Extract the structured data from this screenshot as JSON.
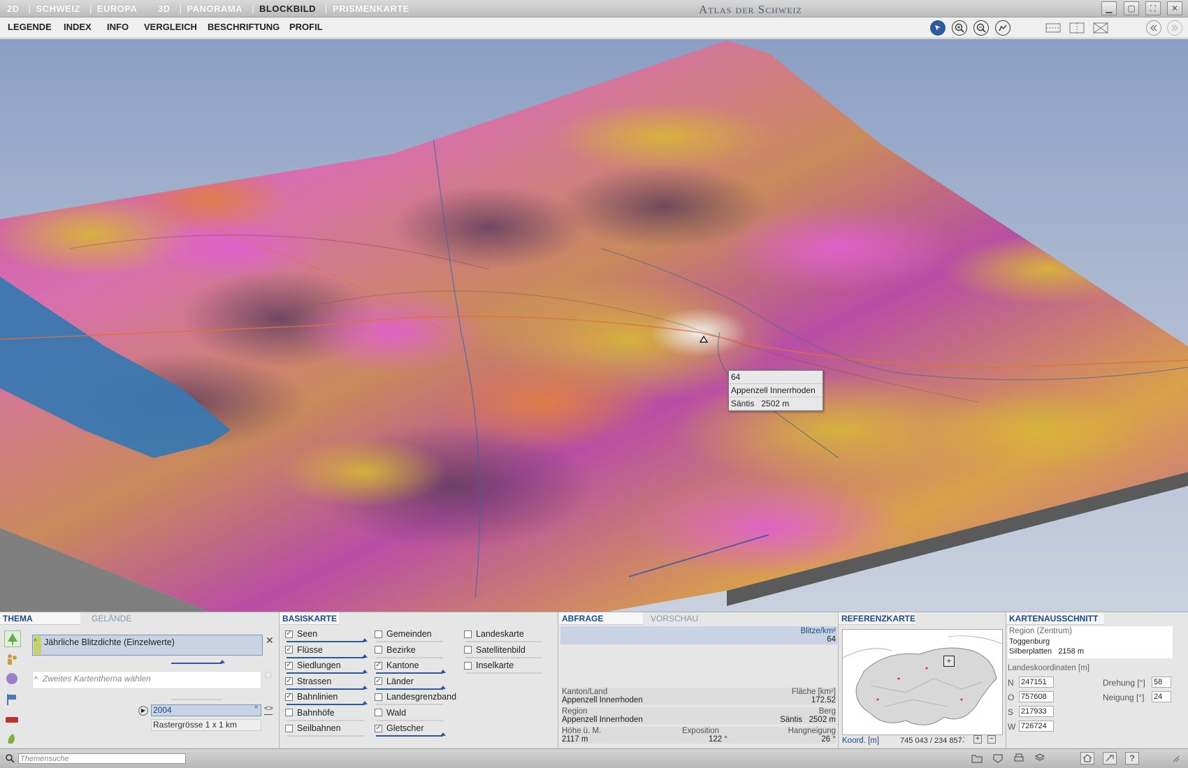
{
  "topbar": {
    "group2d": {
      "label": "2D",
      "items": [
        "SCHWEIZ",
        "EUROPA"
      ]
    },
    "group3d": {
      "label": "3D",
      "items": [
        "PANORAMA",
        "BLOCKBILD",
        "PRISMENKARTE"
      ],
      "active": "BLOCKBILD"
    },
    "title": "Atlas der Schweiz"
  },
  "menu": {
    "items": [
      "LEGENDE",
      "INDEX",
      "INFO",
      "VERGLEICH",
      "BESCHRIFTUNG",
      "PROFIL"
    ]
  },
  "tooltip": {
    "value": "64",
    "region": "Appenzell Innerrhoden",
    "peak_name": "Säntis",
    "peak_height": "2502 m"
  },
  "thema": {
    "tab_active": "THEMA",
    "tab_inactive": "GELÄNDE",
    "primary_theme": "Jährliche Blitzdichte (Einzelwerte)",
    "secondary_placeholder": "Zweites Kartenthema wählen",
    "year": "2004",
    "raster": "Rastergrösse 1 x 1 km"
  },
  "basiskarte": {
    "title": "BASISKARTE",
    "col1": [
      {
        "label": "Seen",
        "checked": true
      },
      {
        "label": "Flüsse",
        "checked": true
      },
      {
        "label": "Siedlungen",
        "checked": true
      },
      {
        "label": "Strassen",
        "checked": true
      },
      {
        "label": "Bahnlinien",
        "checked": true
      },
      {
        "label": "Bahnhöfe",
        "checked": false
      },
      {
        "label": "Seilbahnen",
        "checked": false
      }
    ],
    "col2": [
      {
        "label": "Gemeinden",
        "checked": false
      },
      {
        "label": "Bezirke",
        "checked": false
      },
      {
        "label": "Kantone",
        "checked": true
      },
      {
        "label": "Länder",
        "checked": true
      },
      {
        "label": "Landesgrenzband",
        "checked": false
      },
      {
        "label": "Wald",
        "checked": false
      },
      {
        "label": "Gletscher",
        "checked": true
      }
    ],
    "col3": [
      {
        "label": "Landeskarte",
        "checked": false
      },
      {
        "label": "Satellitenbild",
        "checked": false
      },
      {
        "label": "Inselkarte",
        "checked": false
      }
    ]
  },
  "abfrage": {
    "tab_active": "ABFRAGE",
    "tab_inactive": "VORSCHAU",
    "unit": "Blitze/km²",
    "value": "64",
    "kanton_hdr": "Kanton/Land",
    "kanton_val": "Appenzell Innerrhoden",
    "flaeche_hdr": "Fläche [km²]",
    "flaeche_val": "172.52",
    "region_hdr": "Region",
    "region_val": "Appenzell Innerrhoden",
    "berg_hdr": "Berg",
    "berg_val": "Säntis   2502 m",
    "hoehe_hdr": "Höhe ü. M.",
    "hoehe_val": "2117 m",
    "exposition_hdr": "Exposition",
    "exposition_val": "122 °",
    "neigung_hdr": "Hangneigung",
    "neigung_val": "26 °"
  },
  "referenzkarte": {
    "title": "REFERENZKARTE",
    "coord_label": "Koord. [m]",
    "coord_value": "745 043 / 234 857"
  },
  "kartenausschnitt": {
    "title": "KARTENAUSSCHNITT",
    "region_hdr": "Region (Zentrum)",
    "region": "Toggenburg",
    "peak": "Silberplatten   2158 m",
    "coords_hdr": "Landeskoordinaten [m]",
    "n_label": "N",
    "n_value": "247151",
    "o_label": "O",
    "o_value": "757608",
    "s_label": "S",
    "s_value": "217933",
    "w_label": "W",
    "w_value": "726724",
    "drehung_label": "Drehung [°]",
    "drehung_value": "58",
    "neigung_label": "Neigung [°]",
    "neigung_value": "24"
  },
  "status": {
    "search_placeholder": "Themensuche"
  }
}
